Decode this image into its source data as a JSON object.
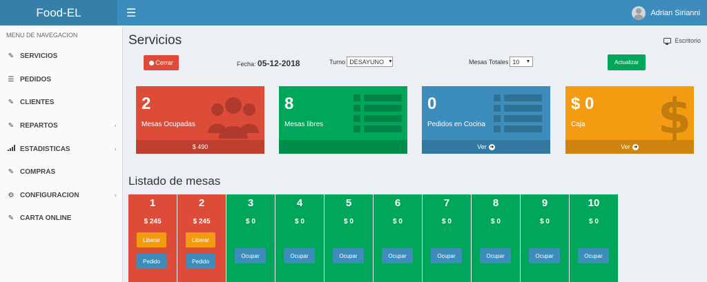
{
  "header": {
    "brand": "Food-EL",
    "menu_icon": "hamburger-icon",
    "user_name": "Adrian Sirianni"
  },
  "sidebar": {
    "section_title": "MENU DE NAVEGACION",
    "items": [
      {
        "label": "SERVICIOS",
        "icon": "edit-icon",
        "chevron": false
      },
      {
        "label": "PEDIDOS",
        "icon": "list-icon",
        "chevron": false
      },
      {
        "label": "CLIENTES",
        "icon": "edit-icon",
        "chevron": false
      },
      {
        "label": "REPARTOS",
        "icon": "edit-icon",
        "chevron": true
      },
      {
        "label": "ESTADISTICAS",
        "icon": "signal-icon",
        "chevron": true
      },
      {
        "label": "COMPRAS",
        "icon": "edit-icon",
        "chevron": false
      },
      {
        "label": "CONFIGURACION",
        "icon": "gear-icon",
        "chevron": true
      },
      {
        "label": "CARTA ONLINE",
        "icon": "edit-icon",
        "chevron": false
      }
    ]
  },
  "page": {
    "title": "Servicios",
    "breadcrumb": "Escritorio",
    "cerrar_label": "Cerrar",
    "fecha_label": "Fecha:",
    "fecha_value": "05-12-2018",
    "turno_label": "Turno",
    "turno_value": "DESAYUNO",
    "mesas_totales_label": "Mesas Totales",
    "mesas_totales_value": "10",
    "actualizar_label": "Actualizar"
  },
  "stats": [
    {
      "value": "2",
      "label": "Mesas Ocupadas",
      "footer": "$ 490",
      "color": "#dd4b39",
      "icon": "users-icon"
    },
    {
      "value": "8",
      "label": "Mesas libres",
      "footer": "",
      "color": "#00a65a",
      "icon": "list-icon"
    },
    {
      "value": "0",
      "label": "Pedidos en Cocina",
      "footer": "Ver",
      "color": "#3c8dbc",
      "icon": "list-icon"
    },
    {
      "value": "$ 0",
      "label": "Caja",
      "footer": "Ver",
      "color": "#f39c12",
      "icon": "dollar-icon"
    }
  ],
  "tables_section": {
    "title": "Listado de mesas"
  },
  "tables": [
    {
      "number": "1",
      "amount": "$ 245",
      "occupied": true,
      "liberar_label": "Liberar",
      "pedido_label": "Pedido"
    },
    {
      "number": "2",
      "amount": "$ 245",
      "occupied": true,
      "liberar_label": "Liberar",
      "pedido_label": "Pedido"
    },
    {
      "number": "3",
      "amount": "$ 0",
      "occupied": false,
      "ocupar_label": "Ocupar"
    },
    {
      "number": "4",
      "amount": "$ 0",
      "occupied": false,
      "ocupar_label": "Ocupar"
    },
    {
      "number": "5",
      "amount": "$ 0",
      "occupied": false,
      "ocupar_label": "Ocupar"
    },
    {
      "number": "6",
      "amount": "$ 0",
      "occupied": false,
      "ocupar_label": "Ocupar"
    },
    {
      "number": "7",
      "amount": "$ 0",
      "occupied": false,
      "ocupar_label": "Ocupar"
    },
    {
      "number": "8",
      "amount": "$ 0",
      "occupied": false,
      "ocupar_label": "Ocupar"
    },
    {
      "number": "9",
      "amount": "$ 0",
      "occupied": false,
      "ocupar_label": "Ocupar"
    },
    {
      "number": "10",
      "amount": "$ 0",
      "occupied": false,
      "ocupar_label": "Ocupar"
    }
  ],
  "colors": {
    "occupied": "#dd4b39",
    "free": "#00a65a",
    "liberar": "#f39c12",
    "blue_btn": "#3c8dbc"
  }
}
